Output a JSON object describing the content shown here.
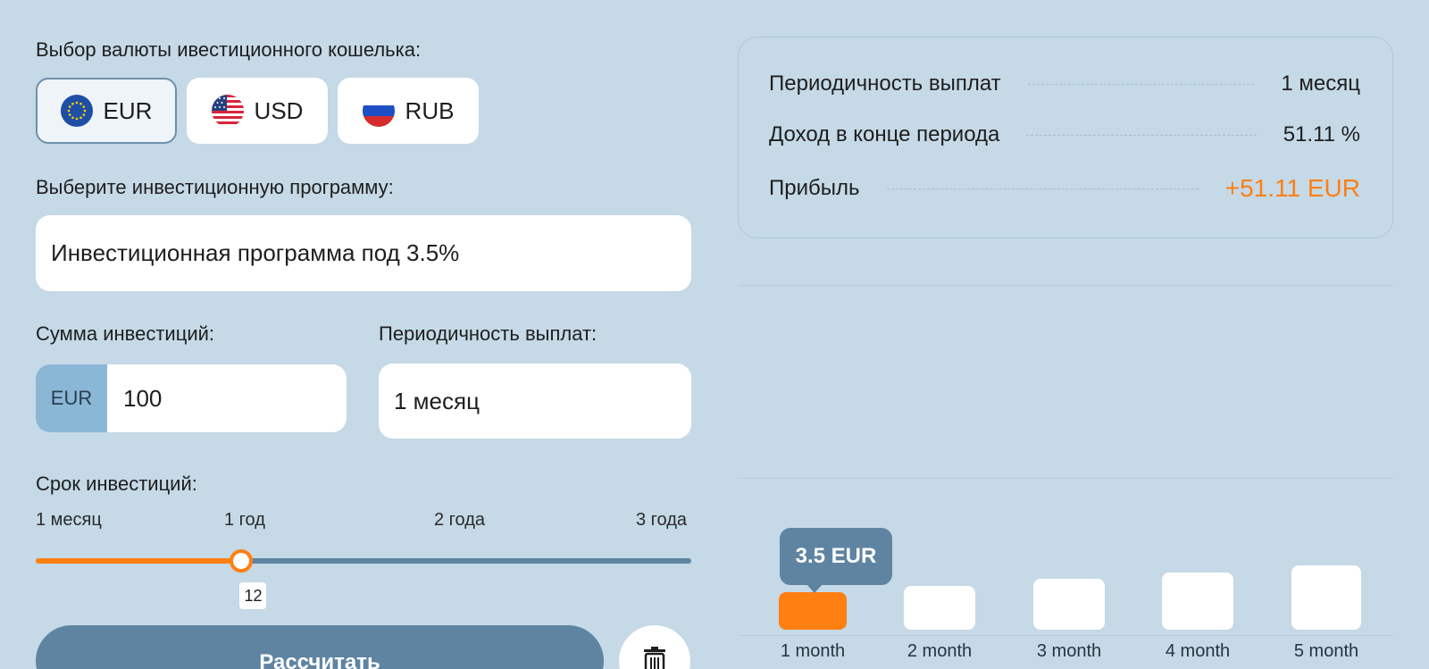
{
  "currency": {
    "label": "Выбор валюты ивестиционного кошелька:",
    "options": [
      {
        "code": "EUR",
        "icon": "eu-flag-icon",
        "active": true
      },
      {
        "code": "USD",
        "icon": "us-flag-icon",
        "active": false
      },
      {
        "code": "RUB",
        "icon": "ru-flag-icon",
        "active": false
      }
    ]
  },
  "program": {
    "label": "Выберите инвестиционную программу:",
    "value": "Инвестиционная программа под 3.5%"
  },
  "amount": {
    "label": "Сумма инвестиций:",
    "prefix": "EUR",
    "value": "100"
  },
  "payout": {
    "label": "Периодичность выплат:",
    "value": "1 месяц"
  },
  "term": {
    "label": "Срок инвестиций:",
    "ticks": [
      "1 месяц",
      "1 год",
      "2 года",
      "3 года"
    ],
    "value": "12",
    "fraction": 0.314
  },
  "actions": {
    "calculate_label": "Рассчитать",
    "delete_icon": "trash-icon"
  },
  "summary": {
    "rows": [
      {
        "label": "Периодичность выплат",
        "value": "1 месяц"
      },
      {
        "label": "Доход в конце периода",
        "value": "51.11 %"
      },
      {
        "label": "Прибыль",
        "value": "+51.11 EUR"
      }
    ]
  },
  "colors": {
    "accent": "#ff7f11",
    "primary": "#5e84a2",
    "background": "#c5d9e6"
  },
  "chart_data": {
    "type": "bar",
    "categories": [
      "1 month",
      "2 month",
      "3 month",
      "4 month",
      "5 month"
    ],
    "values": [
      3.5,
      7.0,
      10.5,
      14.0,
      17.5
    ],
    "highlighted_index": 0,
    "tooltip": "3.5 EUR"
  }
}
